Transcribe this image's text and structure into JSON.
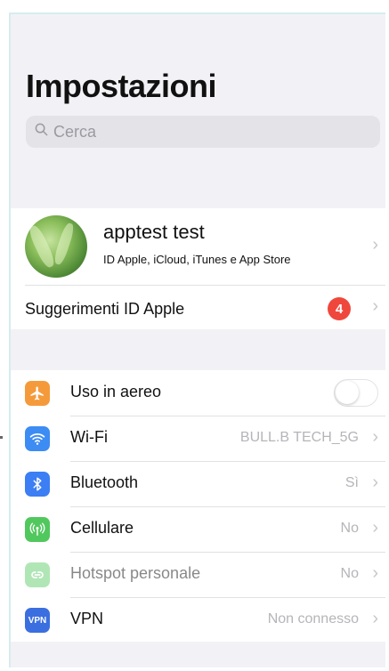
{
  "header": {
    "title": "Impostazioni"
  },
  "search": {
    "placeholder": "Cerca"
  },
  "profile": {
    "name": "apptest test",
    "subtitle": "ID Apple, iCloud, iTunes e App Store"
  },
  "suggestions": {
    "label": "Suggerimenti ID Apple",
    "badge": "4"
  },
  "settings": [
    {
      "label": "Uso in aereo",
      "icon": "airplane-icon",
      "color": "#f59a3b",
      "toggle": false
    },
    {
      "label": "Wi-Fi",
      "icon": "wifi-icon",
      "color": "#3c8cf3",
      "value": "BULL.B TECH_5G"
    },
    {
      "label": "Bluetooth",
      "icon": "bluetooth-icon",
      "color": "#3c7ef3",
      "value": "Sì"
    },
    {
      "label": "Cellulare",
      "icon": "cellular-icon",
      "color": "#51c85d",
      "value": "No"
    },
    {
      "label": "Hotspot personale",
      "icon": "hotspot-icon",
      "color": "#51c85d",
      "value": "No"
    },
    {
      "label": "VPN",
      "icon": "vpn-icon",
      "icon_text": "VPN",
      "color": "#3b6fe0",
      "value": "Non connesso"
    }
  ]
}
